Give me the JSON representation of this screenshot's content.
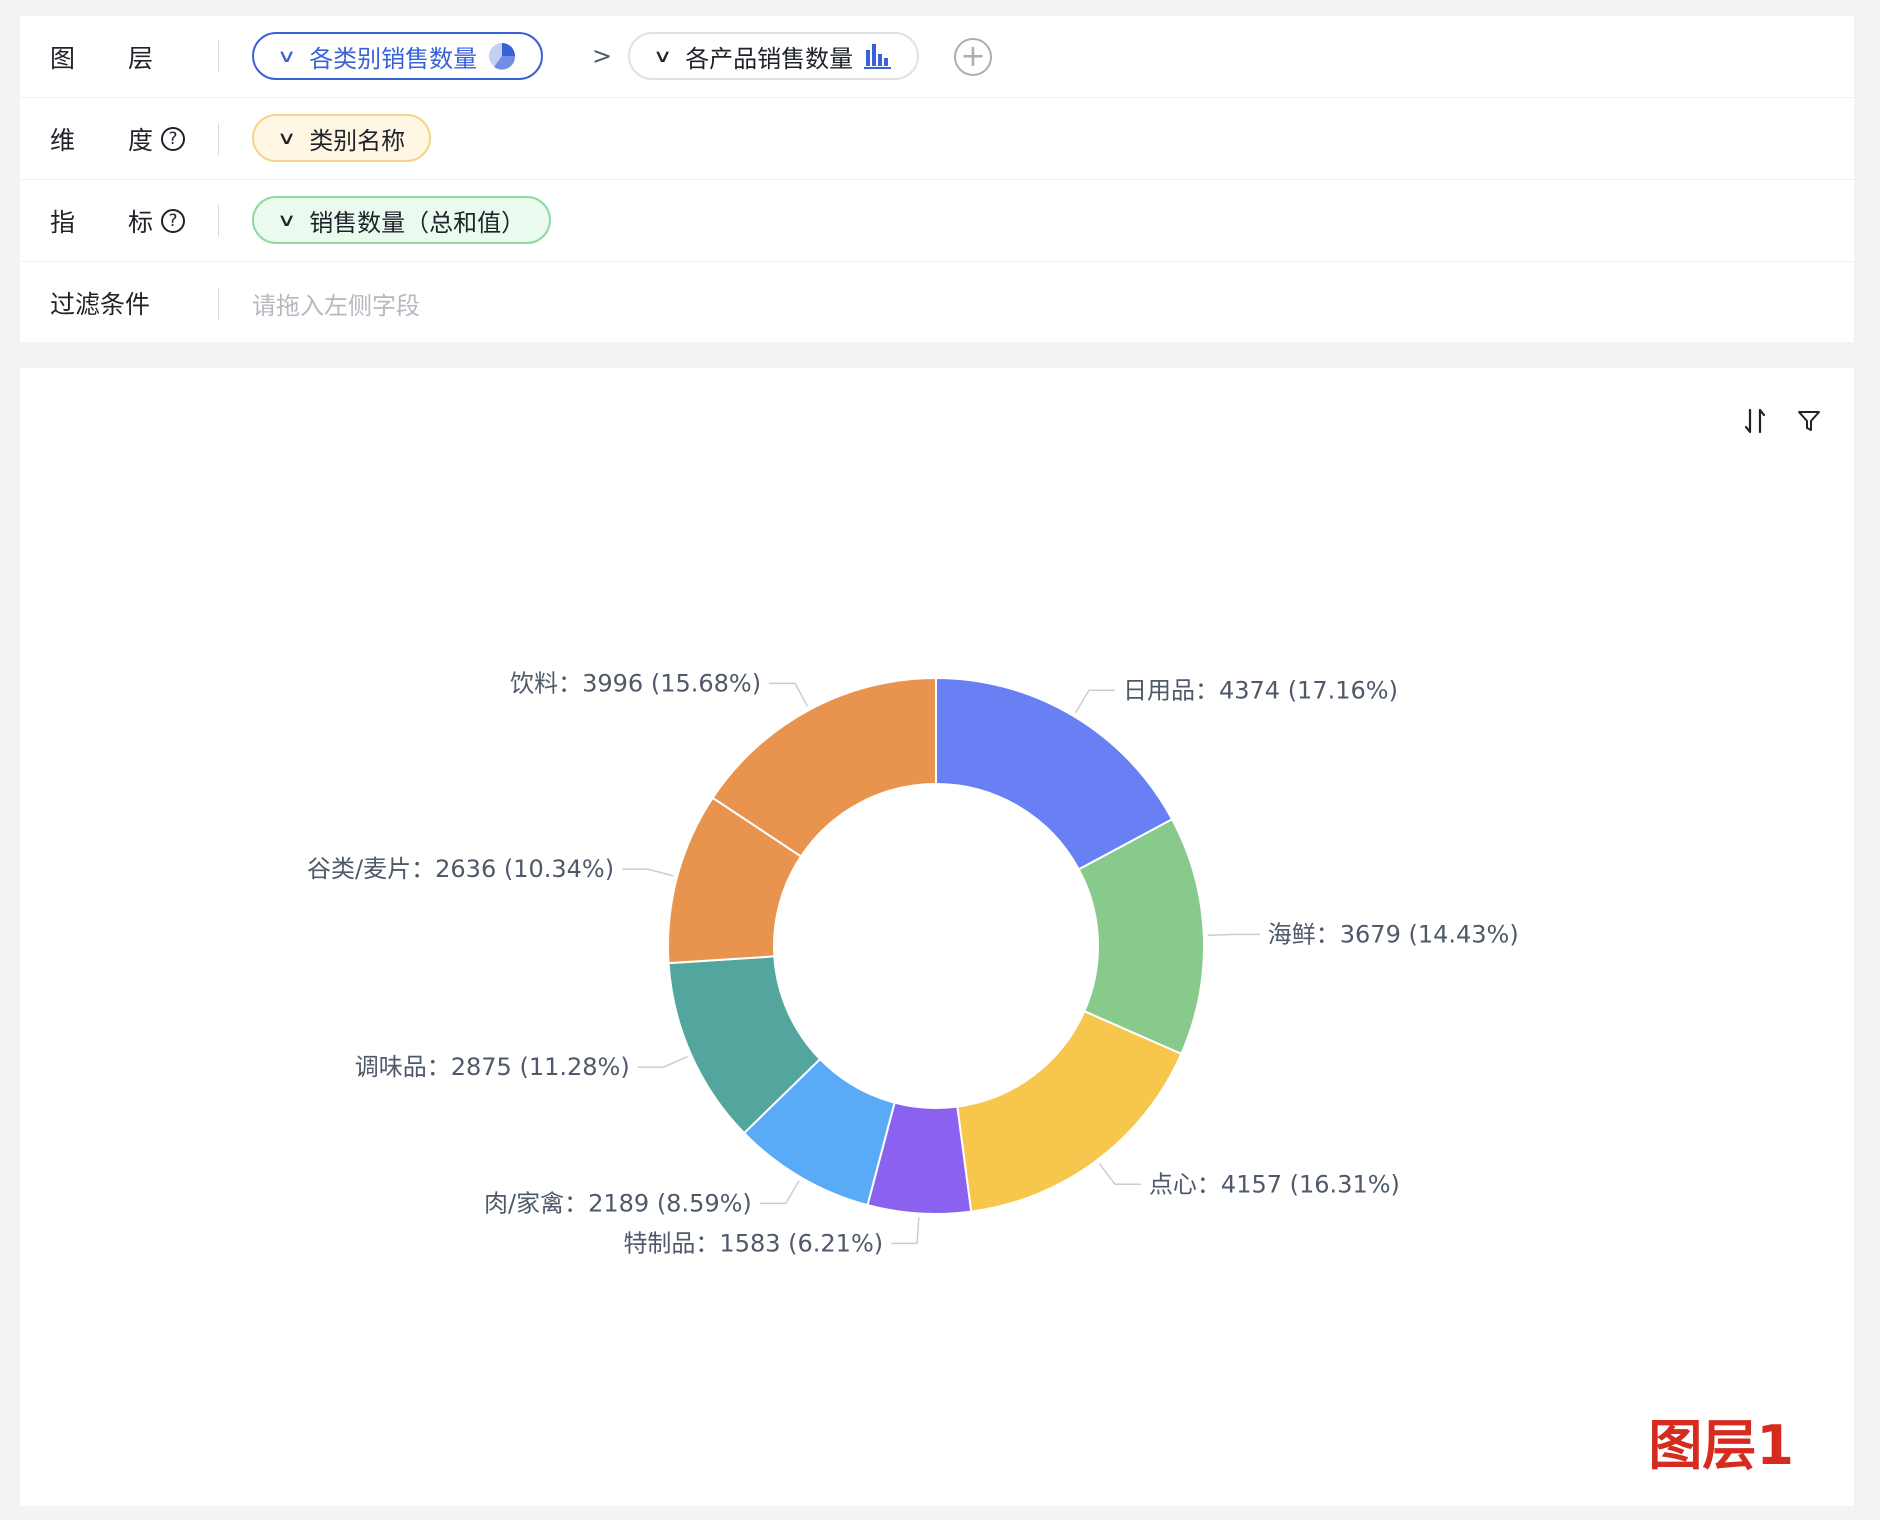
{
  "config": {
    "layer": {
      "label": "图　层",
      "label_a": "图",
      "label_b": "层",
      "items": [
        {
          "label": "各类别销售数量",
          "icon": "pie-chart-icon"
        },
        {
          "label": "各产品销售数量",
          "icon": "bar-chart-icon"
        }
      ],
      "separator": ">",
      "add": "+"
    },
    "dimension": {
      "label_a": "维",
      "label_b": "度",
      "help": "?",
      "value": "类别名称"
    },
    "metric": {
      "label_a": "指",
      "label_b": "标",
      "help": "?",
      "value": "销售数量（总和值）"
    },
    "filter": {
      "label": "过滤条件",
      "placeholder": "请拖入左侧字段"
    }
  },
  "colors": {
    "accent": "#3a62d7",
    "layer_tag": "#d62b1f"
  },
  "toolbar": {
    "sort_icon": "sort-icon",
    "filter_icon": "filter-icon"
  },
  "layer_tag": "图层1",
  "chart_data": {
    "type": "pie",
    "donut": true,
    "slices": [
      {
        "name": "日用品",
        "value": 4374,
        "percent": "17.16%",
        "color": "#6880f4",
        "label": "日用品：4374 (17.16%)"
      },
      {
        "name": "海鲜",
        "value": 3679,
        "percent": "14.43%",
        "color": "#88ca8c",
        "label": "海鲜：3679 (14.43%)"
      },
      {
        "name": "点心",
        "value": 4157,
        "percent": "16.31%",
        "color": "#f7c74d",
        "label": "点心：4157 (16.31%)"
      },
      {
        "name": "特制品",
        "value": 1583,
        "percent": "6.21%",
        "color": "#8b62ef",
        "label": "特制品：1583 (6.21%)"
      },
      {
        "name": "肉/家禽",
        "value": 2189,
        "percent": "8.59%",
        "color": "#5aabf7",
        "label": "肉/家禽：2189 (8.59%)"
      },
      {
        "name": "调味品",
        "value": 2875,
        "percent": "11.28%",
        "color": "#52a69d",
        "label": "调味品：2875 (11.28%)"
      },
      {
        "name": "谷类/麦片",
        "value": 2636,
        "percent": "10.34%",
        "color": "#e8944f",
        "label": "谷类/麦片：2636 (10.34%)"
      },
      {
        "name": "饮料",
        "value": 3996,
        "percent": "15.68%",
        "color": "#e8944f",
        "label": "饮料：3996 (15.68%)"
      }
    ]
  }
}
